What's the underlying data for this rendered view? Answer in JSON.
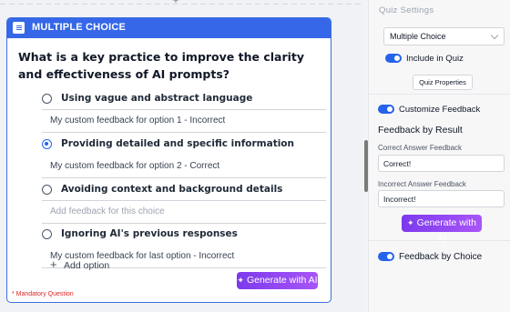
{
  "canvas": {
    "top_add_icon": "plus-icon",
    "card": {
      "type_label": "MULTIPLE CHOICE",
      "type_icon": "list-icon",
      "question": "What is a key practice to improve the clarity and effectiveness of AI prompts?",
      "options": [
        {
          "label": "Using vague and abstract language",
          "selected": false,
          "feedback": "My custom feedback for option 1 - Incorrect",
          "feedback_is_placeholder": false
        },
        {
          "label": "Providing detailed and specific information",
          "selected": true,
          "feedback": "My custom feedback for option 2 - Correct",
          "feedback_is_placeholder": false
        },
        {
          "label": "Avoiding context and background details",
          "selected": false,
          "feedback": "Add feedback for this choice",
          "feedback_is_placeholder": true
        },
        {
          "label": "Ignoring AI's previous responses",
          "selected": false,
          "feedback": "My custom feedback for last option - Incorrect",
          "feedback_is_placeholder": false
        }
      ],
      "add_option_label": "Add option",
      "add_option_icon": "plus-icon",
      "generate_label": "Generate with AI",
      "generate_icon": "sparkle-icon",
      "mandatory_note": "* Mandatory Question"
    }
  },
  "panel": {
    "title": "Quiz Settings",
    "question_type": {
      "value": "Multiple Choice"
    },
    "include_in_quiz": {
      "label": "Include in Quiz",
      "on": true
    },
    "quiz_properties_label": "Quiz Properties",
    "customize_feedback": {
      "label": "Customize Feedback",
      "on": true
    },
    "feedback_by_result": {
      "title": "Feedback by Result",
      "correct_label": "Correct Answer Feedback",
      "correct_value": "Correct!",
      "incorrect_label": "Incorrect Answer Feedback",
      "incorrect_value": "Incorrect!",
      "generate_label": "Generate with AI"
    },
    "feedback_by_choice": {
      "label": "Feedback by Choice",
      "on": true
    }
  },
  "colors": {
    "accent": "#3567e8",
    "generate_gradient_start": "#7c3aed",
    "generate_gradient_end": "#a855f7",
    "mandatory": "#dc2626"
  }
}
